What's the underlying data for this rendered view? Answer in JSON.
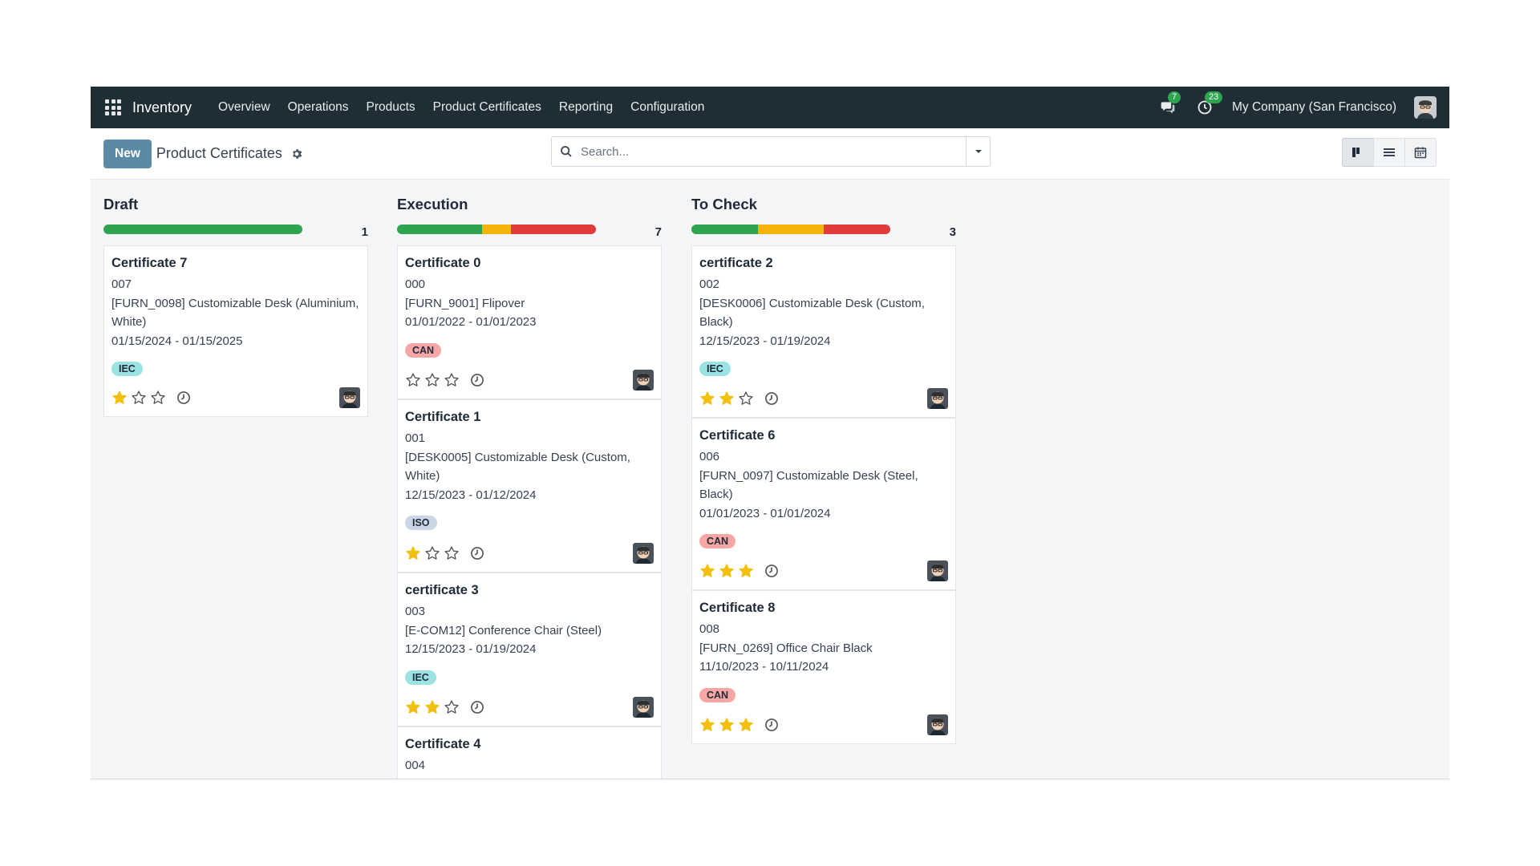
{
  "navbar": {
    "app_name": "Inventory",
    "menu": [
      "Overview",
      "Operations",
      "Products",
      "Product Certificates",
      "Reporting",
      "Configuration"
    ],
    "messages_count": "7",
    "activities_count": "23",
    "company": "My Company (San Francisco)"
  },
  "control_panel": {
    "new_label": "New",
    "breadcrumb": "Product Certificates",
    "search_placeholder": "Search..."
  },
  "colors": {
    "green": "#2fa44f",
    "orange": "#f5b40b",
    "red": "#e03b3b",
    "tag_iec_bg": "#9be2e3",
    "tag_can_bg": "#f7a6a6",
    "tag_iso_bg": "#c9d6e3",
    "star_filled": "#f3c010"
  },
  "columns": [
    {
      "title": "Draft",
      "count": "1",
      "progress": {
        "green": 1,
        "orange": 0,
        "red": 0
      },
      "cards": [
        {
          "title": "Certificate 7",
          "code": "007",
          "product": "[FURN_0098] Customizable Desk (Aluminium, White)",
          "dates": "01/15/2024 - 01/15/2025",
          "tag": "IEC",
          "stars": 1
        }
      ]
    },
    {
      "title": "Execution",
      "count": "7",
      "progress": {
        "green": 3,
        "orange": 1,
        "red": 3
      },
      "cards": [
        {
          "title": "Certificate 0",
          "code": "000",
          "product": "[FURN_9001] Flipover",
          "dates": "01/01/2022 - 01/01/2023",
          "tag": "CAN",
          "stars": 0
        },
        {
          "title": "Certificate 1",
          "code": "001",
          "product": "[DESK0005] Customizable Desk (Custom, White)",
          "dates": "12/15/2023 - 01/12/2024",
          "tag": "ISO",
          "stars": 1
        },
        {
          "title": "certificate 3",
          "code": "003",
          "product": "[E-COM12] Conference Chair (Steel)",
          "dates": "12/15/2023 - 01/19/2024",
          "tag": "IEC",
          "stars": 2
        },
        {
          "title": "Certificate 4",
          "code": "004",
          "product": "",
          "dates": "",
          "tag": "",
          "stars": 0
        }
      ]
    },
    {
      "title": "To Check",
      "count": "3",
      "progress": {
        "green": 1,
        "orange": 1,
        "red": 1
      },
      "cards": [
        {
          "title": "certificate 2",
          "code": "002",
          "product": "[DESK0006] Customizable Desk (Custom, Black)",
          "dates": "12/15/2023 - 01/19/2024",
          "tag": "IEC",
          "stars": 2
        },
        {
          "title": "Certificate 6",
          "code": "006",
          "product": "[FURN_0097] Customizable Desk (Steel, Black)",
          "dates": "01/01/2023 - 01/01/2024",
          "tag": "CAN",
          "stars": 3
        },
        {
          "title": "Certificate 8",
          "code": "008",
          "product": "[FURN_0269] Office Chair Black",
          "dates": "11/10/2023 - 10/11/2024",
          "tag": "CAN",
          "stars": 3
        }
      ]
    }
  ]
}
